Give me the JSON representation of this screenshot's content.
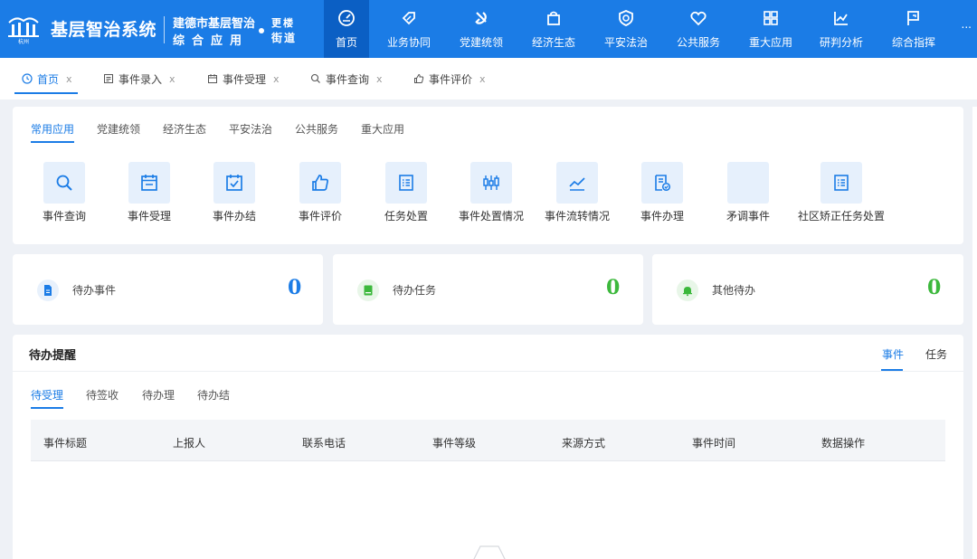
{
  "header": {
    "logo_text": "杭州",
    "system_title": "基层智治系统",
    "org_line1": "建德市基层智治",
    "org_line2": "综合应用",
    "street_line1": "更楼",
    "street_line2": "街道",
    "more": "...",
    "nav": [
      {
        "label": "首页",
        "icon": "dashboard-icon",
        "active": true
      },
      {
        "label": "业务协同",
        "icon": "tag-icon"
      },
      {
        "label": "党建统领",
        "icon": "party-emblem-icon"
      },
      {
        "label": "经济生态",
        "icon": "shopping-bag-icon"
      },
      {
        "label": "平安法治",
        "icon": "shield-icon"
      },
      {
        "label": "公共服务",
        "icon": "heart-icon"
      },
      {
        "label": "重大应用",
        "icon": "grid-icon"
      },
      {
        "label": "研判分析",
        "icon": "chart-line-icon"
      },
      {
        "label": "综合指挥",
        "icon": "flag-icon"
      }
    ]
  },
  "tabs": [
    {
      "label": "首页",
      "icon": "clock-icon",
      "close": "x",
      "active": true
    },
    {
      "label": "事件录入",
      "icon": "form-icon",
      "close": "x"
    },
    {
      "label": "事件受理",
      "icon": "calendar-icon",
      "close": "x"
    },
    {
      "label": "事件查询",
      "icon": "search-icon",
      "close": "x"
    },
    {
      "label": "事件评价",
      "icon": "thumb-up-icon",
      "close": "x"
    }
  ],
  "apps": {
    "categories": [
      "常用应用",
      "党建统领",
      "经济生态",
      "平安法治",
      "公共服务",
      "重大应用"
    ],
    "active_category": "常用应用",
    "items": [
      {
        "label": "事件查询",
        "icon": "search-icon"
      },
      {
        "label": "事件受理",
        "icon": "calendar-icon"
      },
      {
        "label": "事件办结",
        "icon": "calendar-check-icon"
      },
      {
        "label": "事件评价",
        "icon": "thumb-up-icon"
      },
      {
        "label": "任务处置",
        "icon": "list-icon"
      },
      {
        "label": "事件处置情况",
        "icon": "status-bars-icon"
      },
      {
        "label": "事件流转情况",
        "icon": "trend-icon"
      },
      {
        "label": "事件办理",
        "icon": "doc-check-icon"
      },
      {
        "label": "矛调事件",
        "icon": ""
      },
      {
        "label": "社区矫正任务处置",
        "icon": "list-icon"
      }
    ]
  },
  "stats": [
    {
      "label": "待办事件",
      "value": "0",
      "icon": "document-icon",
      "color": "#1b7ce6"
    },
    {
      "label": "待办任务",
      "value": "0",
      "icon": "book-icon",
      "color": "#3cb83c"
    },
    {
      "label": "其他待办",
      "value": "0",
      "icon": "bell-icon",
      "color": "#3cb83c"
    }
  ],
  "reminders": {
    "title": "待办提醒",
    "toggles": [
      "事件",
      "任务"
    ],
    "active_toggle": "事件",
    "sub_tabs": [
      "待受理",
      "待签收",
      "待办理",
      "待办结"
    ],
    "active_sub_tab": "待受理",
    "columns": [
      "事件标题",
      "上报人",
      "联系电话",
      "事件等级",
      "来源方式",
      "事件时间",
      "数据操作"
    ],
    "rows": []
  },
  "colors": {
    "primary": "#1b7ce6",
    "nav_active": "#0b5fc4",
    "green": "#3cb83c",
    "background": "#eef1f6"
  }
}
